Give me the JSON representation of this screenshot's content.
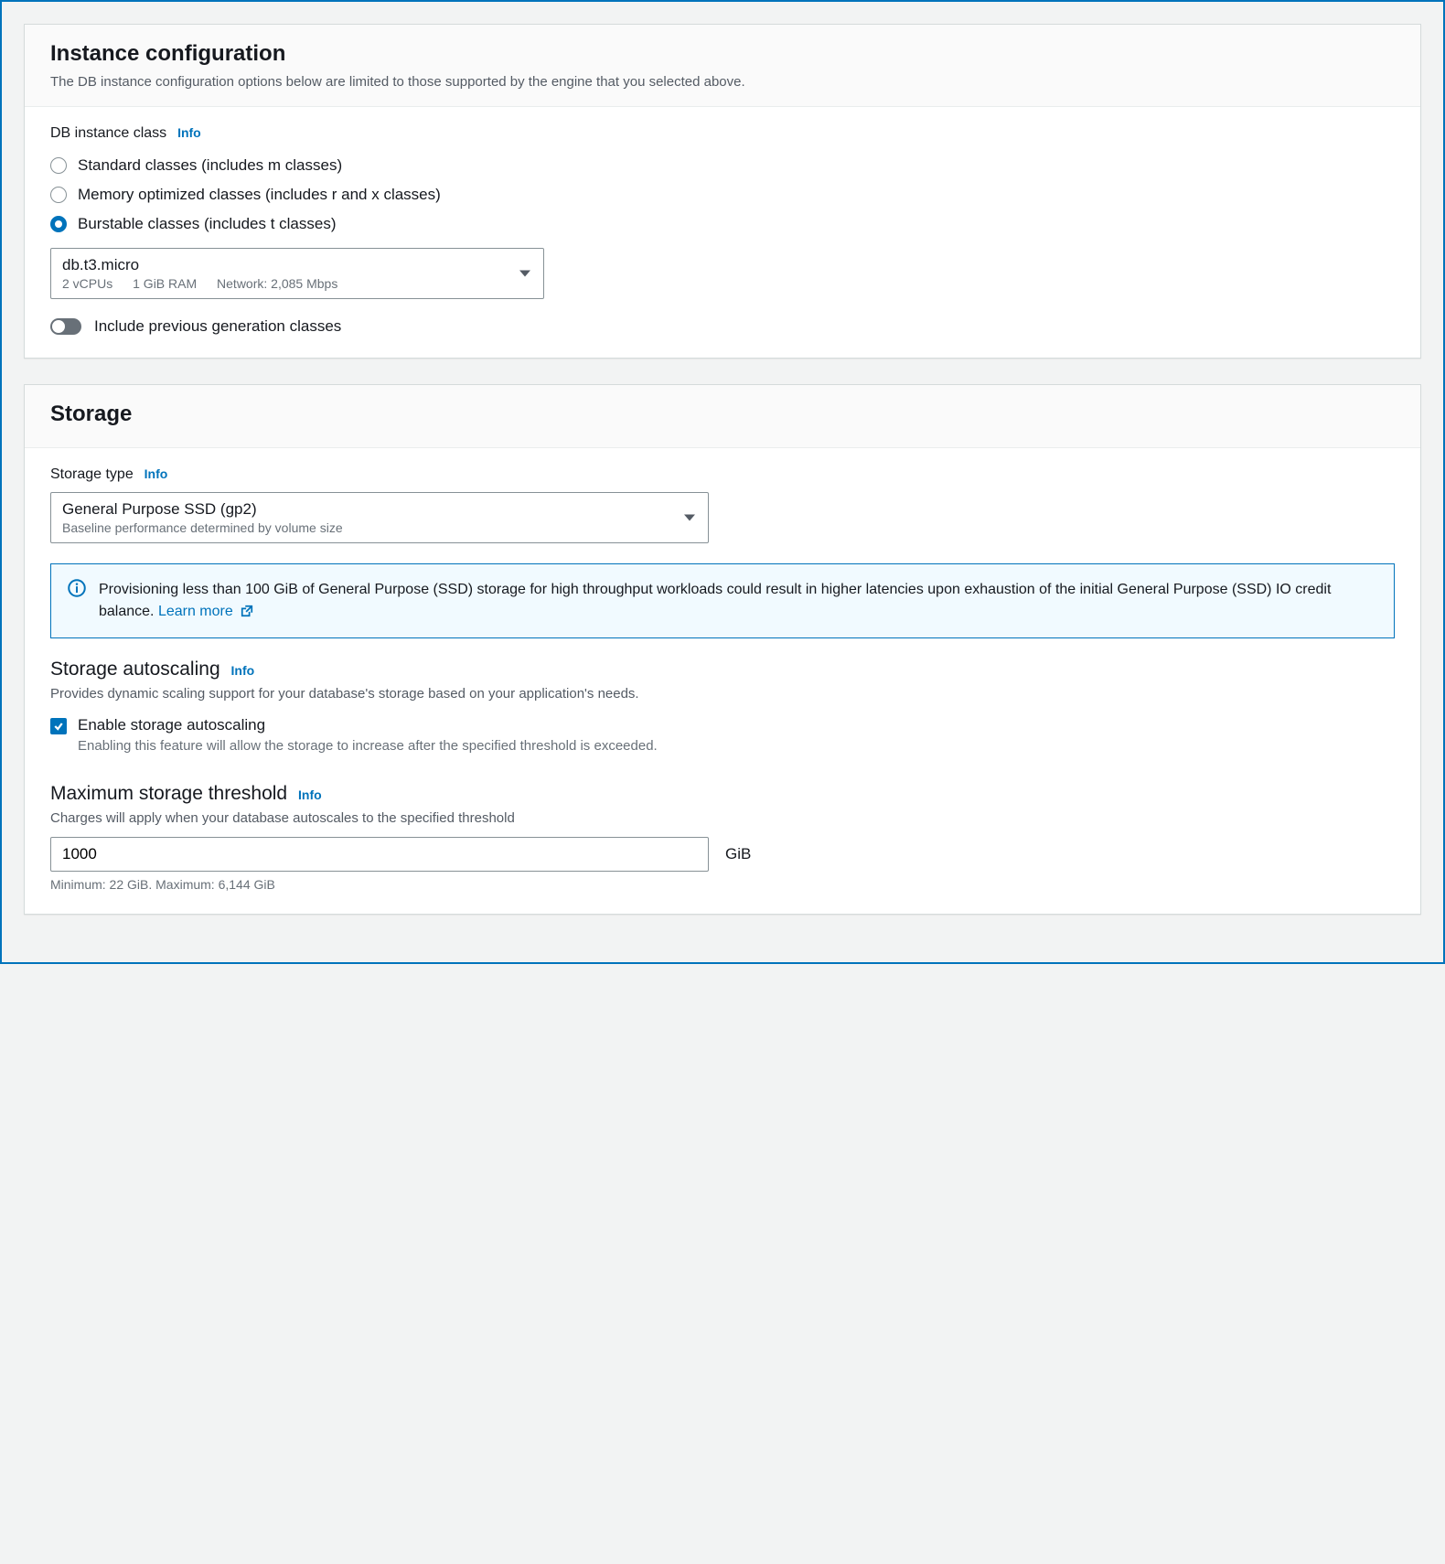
{
  "instance_config": {
    "title": "Instance configuration",
    "subtitle": "The DB instance configuration options below are limited to those supported by the engine that you selected above.",
    "class_label": "DB instance class",
    "info": "Info",
    "options": {
      "standard": "Standard classes (includes m classes)",
      "memory": "Memory optimized classes (includes r and x classes)",
      "burstable": "Burstable classes (includes t classes)"
    },
    "selected": {
      "name": "db.t3.micro",
      "vcpus": "2 vCPUs",
      "ram": "1 GiB RAM",
      "network": "Network: 2,085 Mbps"
    },
    "toggle_label": "Include previous generation classes"
  },
  "storage": {
    "title": "Storage",
    "type_label": "Storage type",
    "info": "Info",
    "type_selected": {
      "name": "General Purpose SSD (gp2)",
      "desc": "Baseline performance determined by volume size"
    },
    "alert_text": "Provisioning less than 100 GiB of General Purpose (SSD) storage for high throughput workloads could result in higher latencies upon exhaustion of the initial General Purpose (SSD) IO credit balance. ",
    "alert_link": "Learn more",
    "autoscaling": {
      "title": "Storage autoscaling",
      "desc": "Provides dynamic scaling support for your database's storage based on your application's needs.",
      "checkbox_label": "Enable storage autoscaling",
      "checkbox_desc": "Enabling this feature will allow the storage to increase after the specified threshold is exceeded."
    },
    "threshold": {
      "title": "Maximum storage threshold",
      "desc": "Charges will apply when your database autoscales to the specified threshold",
      "value": "1000",
      "unit": "GiB",
      "hint": "Minimum: 22 GiB. Maximum: 6,144 GiB"
    }
  }
}
